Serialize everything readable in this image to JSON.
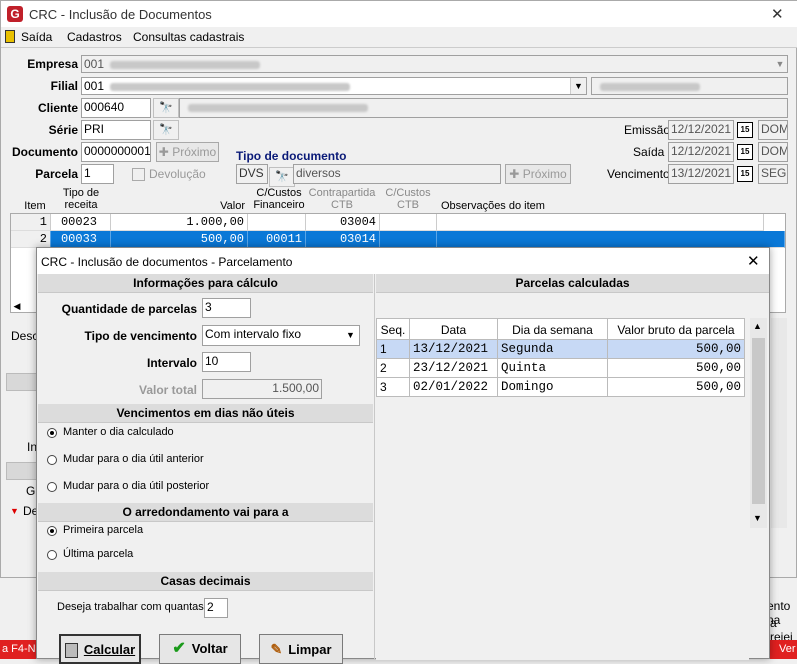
{
  "main_window": {
    "title": "CRC - Inclusão de Documentos",
    "close_glyph": "✕",
    "menu": [
      "Saída",
      "Cadastros",
      "Consultas cadastrais"
    ],
    "fields": {
      "empresa_label": "Empresa",
      "empresa_value": "001",
      "filial_label": "Filial",
      "filial_value": "001",
      "cliente_label": "Cliente",
      "cliente_value": "000640",
      "serie_label": "Série",
      "serie_value": "PRI",
      "documento_label": "Documento",
      "documento_value": "0000000001",
      "proximo_label": "Próximo",
      "parcela_label": "Parcela",
      "parcela_value": "1",
      "devolucao_label": "Devolução",
      "tipo_documento_label": "Tipo de documento",
      "tipo_documento_code": "DVS",
      "tipo_documento_desc": "diversos",
      "proximo2_label": "Próximo",
      "emissao_label": "Emissão",
      "emissao_value": "12/12/2021",
      "emissao_day": "DOM",
      "saida_label": "Saída",
      "saida_value": "12/12/2021",
      "saida_day": "DOM",
      "vencimento_label": "Vencimento",
      "vencimento_value": "13/12/2021",
      "vencimento_day": "SEG",
      "cal_glyph": "15"
    },
    "grid": {
      "headers": {
        "item": "Item",
        "tipo_receita": "Tipo de receita",
        "valor": "Valor",
        "ccustos_fin": "C/Custos Financeiro",
        "contrapartida": "Contrapartida CTB",
        "ccustos_ctb": "C/Custos CTB",
        "obs": "Observações do item"
      },
      "rows": [
        {
          "item": "1",
          "tipo": "00023",
          "valor": "1.000,00",
          "ccf": "",
          "contra": "03004",
          "ccc": "",
          "obs": ""
        },
        {
          "item": "2",
          "tipo": "00033",
          "valor": "500,00",
          "ccf": "00011",
          "contra": "03014",
          "ccc": "",
          "obs": ""
        }
      ]
    },
    "partial_labels": {
      "desc": "Desc",
      "in": "In",
      "gr": "Gr",
      "de": "De",
      "ento_na": "ento na",
      "a_rejei": "a rejei",
      "status_left": "a F4-Ne",
      "status_right": "Ver",
      "right_00": "00"
    }
  },
  "dialog": {
    "title": "CRC - Inclusão de documentos - Parcelamento",
    "close_glyph": "✕",
    "info_header": "Informações para cálculo",
    "qtd_label": "Quantidade de parcelas",
    "qtd_value": "3",
    "tipo_venc_label": "Tipo de vencimento",
    "tipo_venc_value": "Com intervalo fixo",
    "intervalo_label": "Intervalo",
    "intervalo_value": "10",
    "valor_total_label": "Valor total",
    "valor_total_value": "1.500,00",
    "dias_header": "Vencimentos em dias não úteis",
    "dias_options": [
      "Manter o dia calculado",
      "Mudar para o dia útil anterior",
      "Mudar para o dia útil posterior"
    ],
    "dias_selected": 0,
    "arred_header": "O arredondamento vai para a",
    "arred_options": [
      "Primeira parcela",
      "Última parcela"
    ],
    "arred_selected": 0,
    "casas_header": "Casas decimais",
    "casas_label": "Deseja trabalhar com quantas",
    "casas_value": "2",
    "parcelas_header": "Parcelas calculadas",
    "table_headers": [
      "Seq.",
      "Data",
      "Dia da semana",
      "Valor bruto da parcela"
    ],
    "table_rows": [
      {
        "seq": "1",
        "data": "13/12/2021",
        "dia": "Segunda",
        "valor": "500,00"
      },
      {
        "seq": "2",
        "data": "23/12/2021",
        "dia": "Quinta",
        "valor": "500,00"
      },
      {
        "seq": "3",
        "data": "02/01/2022",
        "dia": "Domingo",
        "valor": "500,00"
      }
    ],
    "buttons": {
      "calcular": "Calcular",
      "voltar": "Voltar",
      "limpar": "Limpar"
    }
  },
  "colors": {
    "accent": "#0a78d7",
    "brand": "#c0202a",
    "status_red": "#e02020",
    "selected_row": "#c7d9f5"
  }
}
